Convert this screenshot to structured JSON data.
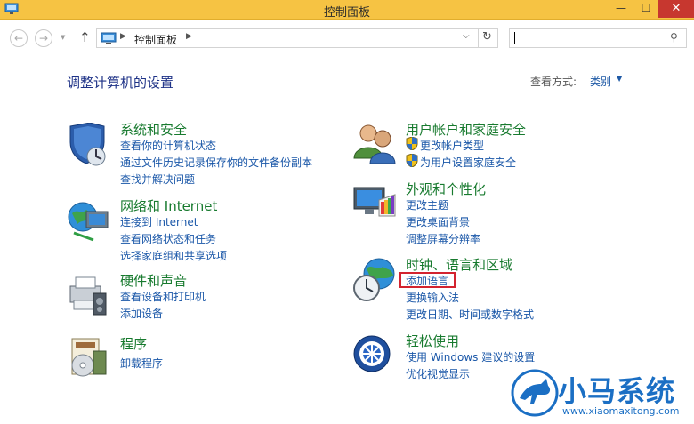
{
  "window": {
    "title": "控制面板",
    "min_glyph": "—",
    "max_glyph": "☐",
    "close_glyph": "✕"
  },
  "nav": {
    "back_glyph": "←",
    "forward_glyph": "→",
    "history_glyph": "▼",
    "up_glyph": "↑",
    "breadcrumb": "控制面板",
    "breadcrumb_sep": "▶",
    "dropdown_glyph": "⌵",
    "refresh_glyph": "↻",
    "search_value": "",
    "search_glyph": "⚲"
  },
  "main": {
    "heading": "调整计算机的设置",
    "view_by_label": "查看方式:",
    "view_by_value": "类别",
    "view_by_caret": "▼"
  },
  "categories": {
    "security": {
      "title": "系统和安全",
      "links": [
        "查看你的计算机状态",
        "通过文件历史记录保存你的文件备份副本",
        "查找并解决问题"
      ]
    },
    "network": {
      "title": "网络和 Internet",
      "links": [
        "连接到 Internet",
        "查看网络状态和任务",
        "选择家庭组和共享选项"
      ]
    },
    "hardware": {
      "title": "硬件和声音",
      "links": [
        "查看设备和打印机",
        "添加设备"
      ]
    },
    "programs": {
      "title": "程序",
      "links": [
        "卸载程序"
      ]
    },
    "accounts": {
      "title": "用户帐户和家庭安全",
      "links": [
        "更改帐户类型",
        "为用户设置家庭安全"
      ]
    },
    "appearance": {
      "title": "外观和个性化",
      "links": [
        "更改主题",
        "更改桌面背景",
        "调整屏幕分辨率"
      ]
    },
    "clock": {
      "title": "时钟、语言和区域",
      "links": [
        "添加语言",
        "更换输入法",
        "更改日期、时间或数字格式"
      ]
    },
    "ease": {
      "title": "轻松使用",
      "links": [
        "使用 Windows 建议的设置",
        "优化视觉显示"
      ]
    }
  },
  "watermark": {
    "name": "小马系统",
    "url": "www.xiaomaxitong.com"
  },
  "colors": {
    "titlebar": "#f6c343",
    "category_title": "#177a2e",
    "link": "#1a57a8",
    "highlight_box": "#d3232f",
    "logo": "#1b6fc4"
  }
}
